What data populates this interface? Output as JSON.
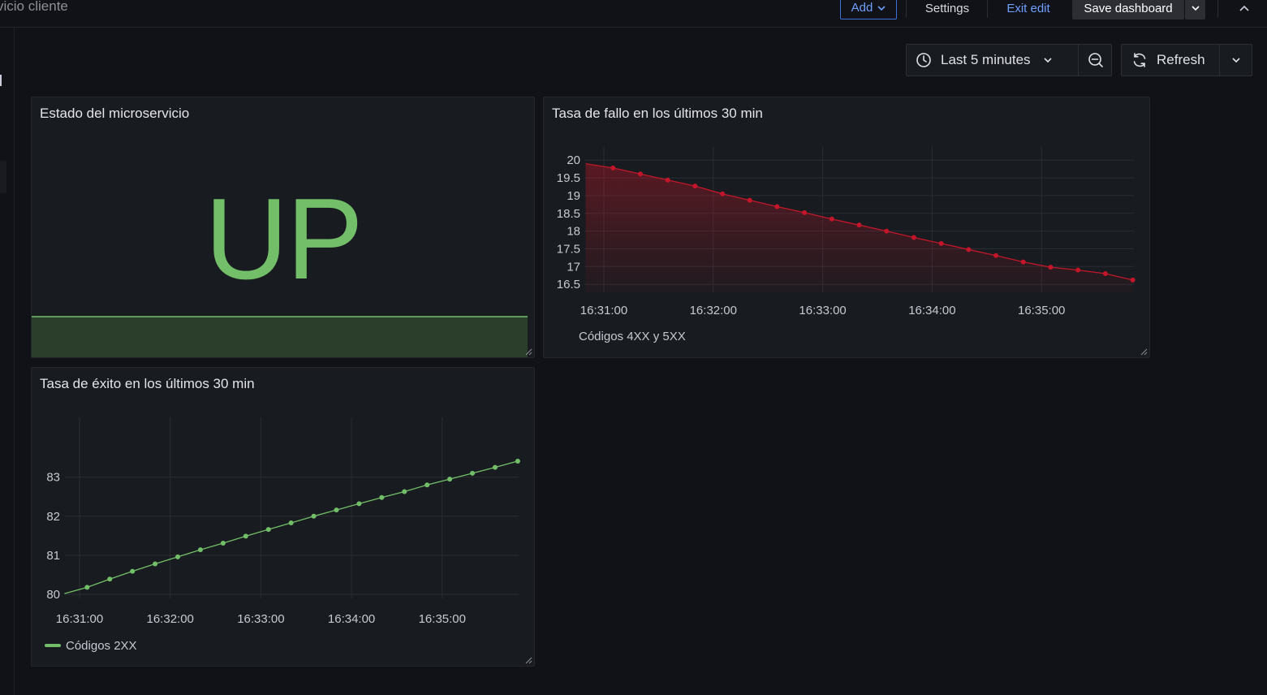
{
  "topbar": {
    "breadcrumb": "vicio cliente",
    "add_label": "Add",
    "settings_label": "Settings",
    "exit_edit_label": "Exit edit",
    "save_label": "Save dashboard"
  },
  "time_controls": {
    "range_label": "Last 5 minutes",
    "refresh_label": "Refresh"
  },
  "colors": {
    "accent_blue": "#6e9fff",
    "success_green": "#73bf69",
    "failure_red": "#c4162a",
    "panel_bg": "#181b1f",
    "page_bg": "#111217"
  },
  "panels": {
    "status": {
      "title": "Estado del microservicio",
      "value": "UP"
    },
    "failure": {
      "title": "Tasa de fallo en los últimos 30 min",
      "legend": "Códigos 4XX y 5XX"
    },
    "success": {
      "title": "Tasa de éxito en los últimos 30 min",
      "legend": "Códigos 2XX"
    }
  },
  "chart_data": [
    {
      "type": "area",
      "title": "Tasa de fallo en los últimos 30 min",
      "x_ticks": [
        "16:31:00",
        "16:32:00",
        "16:33:00",
        "16:34:00",
        "16:35:00"
      ],
      "y_ticks": [
        "20",
        "19.5",
        "19",
        "18.5",
        "18",
        "17.5",
        "17",
        "16.5"
      ],
      "ylim": [
        16.4,
        20.2
      ],
      "x_start": "16:30:50",
      "x_step_seconds": 15,
      "series": [
        {
          "name": "Códigos 4XX y 5XX",
          "color": "#c4162a",
          "values": [
            19.9,
            19.78,
            19.61,
            19.44,
            19.27,
            19.05,
            18.87,
            18.69,
            18.52,
            18.34,
            18.17,
            18.0,
            17.82,
            17.65,
            17.48,
            17.31,
            17.13,
            16.98,
            16.9,
            16.8,
            16.62
          ]
        }
      ],
      "legend": "Códigos 4XX y 5XX",
      "grid": true
    },
    {
      "type": "line",
      "title": "Tasa de éxito en los últimos 30 min",
      "x_ticks": [
        "16:31:00",
        "16:32:00",
        "16:33:00",
        "16:34:00",
        "16:35:00"
      ],
      "y_ticks": [
        "83",
        "82",
        "81",
        "80"
      ],
      "ylim": [
        79.98,
        83.7
      ],
      "x_start": "16:30:50",
      "x_step_seconds": 15,
      "series": [
        {
          "name": "Códigos 2XX",
          "color": "#73bf69",
          "values": [
            80.02,
            80.18,
            80.39,
            80.59,
            80.78,
            80.96,
            81.14,
            81.31,
            81.49,
            81.66,
            81.83,
            82.0,
            82.16,
            82.32,
            82.48,
            82.63,
            82.8,
            82.95,
            83.1,
            83.25,
            83.41
          ]
        }
      ],
      "legend": "Códigos 2XX",
      "grid": true
    }
  ]
}
